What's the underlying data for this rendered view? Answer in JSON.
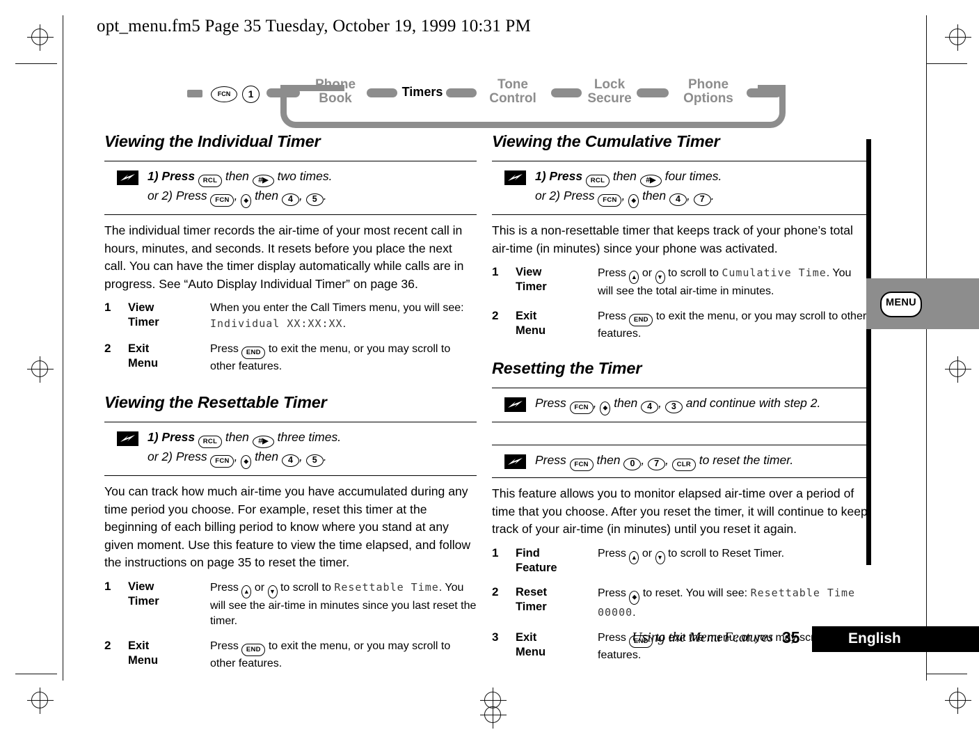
{
  "file_header": "opt_menu.fm5  Page 35  Tuesday, October 19, 1999  10:31 PM",
  "nav": {
    "start_keys": [
      "FCN",
      "1"
    ],
    "items": [
      {
        "label_line1": "Phone",
        "label_line2": "Book",
        "active": false
      },
      {
        "label_line1": "Timers",
        "label_line2": "",
        "active": true
      },
      {
        "label_line1": "Tone",
        "label_line2": "Control",
        "active": false
      },
      {
        "label_line1": "Lock",
        "label_line2": "Secure",
        "active": false
      },
      {
        "label_line1": "Phone",
        "label_line2": "Options",
        "active": false
      }
    ]
  },
  "left_column": {
    "section1": {
      "heading": "Viewing the Individual Timer",
      "tip": {
        "line1_pre": "1) Press",
        "line1_key1": "RCL",
        "line1_mid": "then",
        "line1_key2": "#",
        "line1_post": "two times.",
        "line2_pre": "or 2) Press",
        "line2_key1": "FCN",
        "line2_mid": "then",
        "line2_key2": "4",
        "line2_key3": "5"
      },
      "paragraph": "The individual timer records the air-time of your most recent call in hours, minutes, and seconds. It resets before you place the next call. You can have the timer display automatically while calls are in progress. See “Auto Display Individual Timer” on page 36.",
      "steps": [
        {
          "num": "1",
          "name_line1": "View",
          "name_line2": "Timer",
          "desc_pre": "When you enter the Call Timers menu, you will see:",
          "desc_lcd": "Individual XX:XX:XX",
          "desc_post": "."
        },
        {
          "num": "2",
          "name_line1": "Exit",
          "name_line2": "Menu",
          "desc_pre": "Press",
          "desc_key": "END",
          "desc_post": "to exit the menu, or you may scroll to other features."
        }
      ]
    },
    "section2": {
      "heading": "Viewing the Resettable Timer",
      "tip": {
        "line1_pre": "1) Press",
        "line1_key1": "RCL",
        "line1_mid": "then",
        "line1_key2": "#",
        "line1_post": "three times.",
        "line2_pre": "or 2) Press",
        "line2_key1": "FCN",
        "line2_mid": "then",
        "line2_key2": "4",
        "line2_key3": "5"
      },
      "paragraph": "You can track how much air-time you have accumulated during any time period you choose. For example, reset this timer at the beginning of each billing period to know where you stand at any given moment. Use this feature to view the time elapsed, and follow the instructions on page 35 to reset the timer.",
      "steps": [
        {
          "num": "1",
          "name_line1": "View",
          "name_line2": "Timer",
          "desc_pre": "Press",
          "desc_mid": "or",
          "desc_mid2": "to scroll to",
          "desc_lcd": "Resettable Time",
          "desc_post": ". You will see the air-time in minutes since you last reset the timer."
        },
        {
          "num": "2",
          "name_line1": "Exit",
          "name_line2": "Menu",
          "desc_pre": "Press",
          "desc_key": "END",
          "desc_post": "to exit the menu, or you may scroll to other features."
        }
      ]
    }
  },
  "right_column": {
    "section1": {
      "heading": "Viewing the Cumulative Timer",
      "tip": {
        "line1_pre": "1) Press",
        "line1_key1": "RCL",
        "line1_mid": "then",
        "line1_key2": "#",
        "line1_post": "four times.",
        "line2_pre": "or 2) Press",
        "line2_key1": "FCN",
        "line2_mid": "then",
        "line2_key2": "4",
        "line2_key3": "7"
      },
      "paragraph": "This is a non-resettable timer that keeps track of your phone’s total air-time (in minutes) since your phone was activated.",
      "steps": [
        {
          "num": "1",
          "name_line1": "View",
          "name_line2": "Timer",
          "desc_pre": "Press",
          "desc_mid": "or",
          "desc_mid2": "to scroll to",
          "desc_lcd": "Cumulative Time",
          "desc_post": ". You will see the total air-time in minutes."
        },
        {
          "num": "2",
          "name_line1": "Exit",
          "name_line2": "Menu",
          "desc_pre": "Press",
          "desc_key": "END",
          "desc_post": "to exit the menu, or you may scroll to other features."
        }
      ]
    },
    "section2": {
      "heading": "Resetting the Timer",
      "tip_a": {
        "pre": "Press",
        "key1": "FCN",
        "mid": "then",
        "key2": "4",
        "key3": "3",
        "post": "and continue with step 2."
      },
      "tip_b": {
        "pre": "Press",
        "key1": "FCN",
        "mid": "then",
        "key2": "0",
        "key3": "7",
        "key4": "CLR",
        "post": "to reset the timer."
      },
      "paragraph": "This feature allows you to monitor elapsed air-time over a period of time that you choose. After you reset the timer, it will continue to keep track of your air-time (in minutes) until you reset it again.",
      "steps": [
        {
          "num": "1",
          "name_line1": "Find",
          "name_line2": "Feature",
          "desc_pre": "Press",
          "desc_mid": "or",
          "desc_mid2": "to scroll to Reset Timer."
        },
        {
          "num": "2",
          "name_line1": "Reset",
          "name_line2": "Timer",
          "desc_pre": "Press",
          "desc_mid": "to reset. You will see:",
          "desc_lcd": "Resettable Time",
          "desc_lcd2": "00000",
          "desc_post": "."
        },
        {
          "num": "3",
          "name_line1": "Exit",
          "name_line2": "Menu",
          "desc_pre": "Press",
          "desc_key": "END",
          "desc_post": "to exit the menu, or you may scroll to other features."
        }
      ]
    }
  },
  "side_tab": {
    "menu_label": "MENU"
  },
  "footer": {
    "note": "Using the Menu Features",
    "page_number": "35",
    "language": "English"
  },
  "colors": {
    "gray": "#8d8d8d",
    "black": "#000000"
  }
}
